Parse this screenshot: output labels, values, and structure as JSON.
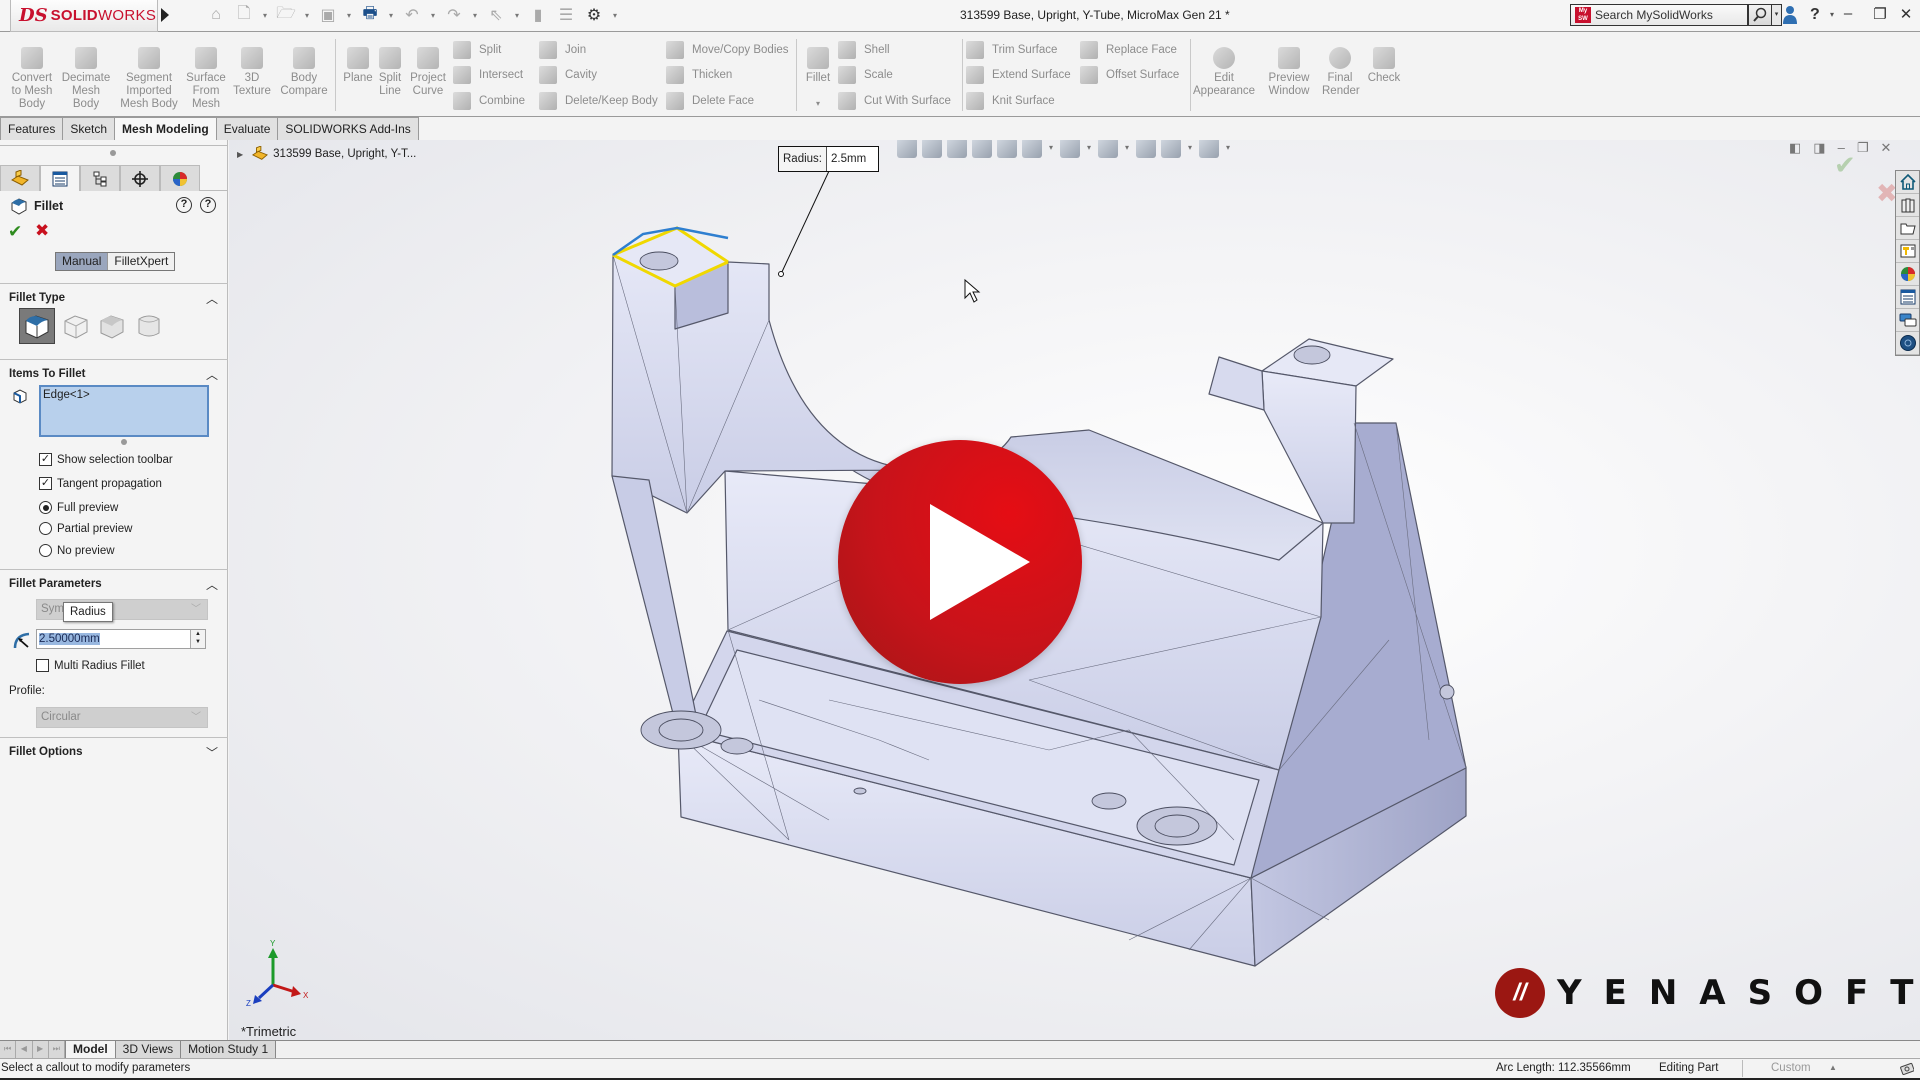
{
  "app": {
    "brand_prefix": "DS",
    "brand_bold": "SOLID",
    "brand_light": "WORKS",
    "document_title": "313599 Base, Upright, Y-Tube, MicroMax Gen 21 *",
    "search_placeholder": "Search MySolidWorks",
    "mysw_badge": "My SW",
    "help_label": "?"
  },
  "quick_access": [
    "home-icon",
    "new-document-icon",
    "open-icon",
    "save-icon",
    "print-icon",
    "undo-icon",
    "redo-icon",
    "select-icon",
    "rebuild-icon",
    "file-properties-icon",
    "options-icon"
  ],
  "command_manager": {
    "large_buttons": [
      {
        "id": "convert-to-mesh-body",
        "lines": [
          "Convert",
          "to Mesh",
          "Body"
        ]
      },
      {
        "id": "decimate-mesh-body",
        "lines": [
          "Decimate",
          "Mesh",
          "Body"
        ]
      },
      {
        "id": "segment-imported-mesh-body",
        "lines": [
          "Segment",
          "Imported",
          "Mesh Body"
        ]
      },
      {
        "id": "surface-from-mesh",
        "lines": [
          "Surface",
          "From",
          "Mesh"
        ]
      },
      {
        "id": "3d-texture",
        "lines": [
          "3D",
          "Texture"
        ]
      },
      {
        "id": "body-compare",
        "lines": [
          "Body",
          "Compare"
        ]
      },
      {
        "id": "plane",
        "lines": [
          "Plane"
        ]
      },
      {
        "id": "split-line",
        "lines": [
          "Split",
          "Line"
        ]
      },
      {
        "id": "project-curve",
        "lines": [
          "Project",
          "Curve"
        ]
      },
      {
        "id": "fillet",
        "lines": [
          "Fillet"
        ]
      },
      {
        "id": "edit-appearance",
        "lines": [
          "Edit",
          "Appearance"
        ]
      },
      {
        "id": "preview-window",
        "lines": [
          "Preview",
          "Window"
        ]
      },
      {
        "id": "final-render",
        "lines": [
          "Final",
          "Render"
        ]
      },
      {
        "id": "check",
        "lines": [
          "Check"
        ]
      }
    ],
    "small_buttons": {
      "split": "Split",
      "intersect": "Intersect",
      "combine": "Combine",
      "join": "Join",
      "cavity": "Cavity",
      "delete_keep_body": "Delete/Keep Body",
      "move_copy_bodies": "Move/Copy Bodies",
      "thicken": "Thicken",
      "delete_face": "Delete Face",
      "shell": "Shell",
      "scale": "Scale",
      "cut_with_surface": "Cut With Surface",
      "trim_surface": "Trim Surface",
      "extend_surface": "Extend Surface",
      "knit_surface": "Knit Surface",
      "replace_face": "Replace Face",
      "offset_surface": "Offset Surface"
    },
    "tabs": [
      {
        "label": "Features",
        "active": false
      },
      {
        "label": "Sketch",
        "active": false
      },
      {
        "label": "Mesh Modeling",
        "active": true
      },
      {
        "label": "Evaluate",
        "active": false
      },
      {
        "label": "SOLIDWORKS Add-Ins",
        "active": false
      }
    ]
  },
  "property_manager": {
    "title": "Fillet",
    "help_label": "?",
    "ok_symbol": "✔",
    "cancel_symbol": "✖",
    "modes": {
      "manual": "Manual",
      "filletxpert": "FilletXpert",
      "active": "Manual"
    },
    "sections": {
      "fillet_type": "Fillet Type",
      "items_to_fillet": "Items To Fillet",
      "fillet_parameters": "Fillet Parameters",
      "fillet_options": "Fillet Options"
    },
    "fillet_type_selected": "Constant Size Fillet",
    "items": [
      "Edge<1>"
    ],
    "options": {
      "show_selection_toolbar": {
        "label": "Show selection toolbar",
        "checked": true
      },
      "tangent_propagation": {
        "label": "Tangent propagation",
        "checked": true
      }
    },
    "preview": {
      "full": "Full preview",
      "partial": "Partial preview",
      "none": "No preview",
      "selected": "Full preview"
    },
    "parameters": {
      "method_select_value": "Symmetric",
      "method_select_visible": "Symr",
      "tooltip": "Radius",
      "radius_value": "2.50000mm",
      "multi_radius_label": "Multi Radius Fillet",
      "multi_radius_checked": false,
      "profile_label": "Profile:",
      "profile_value": "Circular"
    }
  },
  "viewport": {
    "tree_root": "313599 Base, Upright, Y-T...",
    "callout": {
      "label": "Radius:",
      "value": "2.5mm"
    },
    "view_orientation": "*Trimetric",
    "triad": {
      "x": "X",
      "y": "Y",
      "z": "Z"
    },
    "watermark": {
      "mark": "//",
      "name": "YENASOFT"
    },
    "task_pane": [
      "solidworks-resources-icon",
      "design-library-icon",
      "file-explorer-icon",
      "view-palette-icon",
      "appearances-scenes-icon",
      "custom-properties-icon",
      "solidworks-forum-icon",
      "solidworks-3dexperience-icon"
    ]
  },
  "bottom_tabs": [
    {
      "label": "Model",
      "active": true
    },
    {
      "label": "3D Views",
      "active": false
    },
    {
      "label": "Motion Study 1",
      "active": false
    }
  ],
  "status": {
    "message": "Select a callout to modify parameters",
    "arc_length": "Arc Length: 112.35566mm",
    "mode": "Editing Part",
    "units": "Custom"
  },
  "colors": {
    "brand_red": "#c8102e",
    "play_red": "#d3121a",
    "selection_yellow": "#f0d800",
    "selection_blue": "#2e7fd0",
    "active_mode": "#9aa6bd"
  }
}
